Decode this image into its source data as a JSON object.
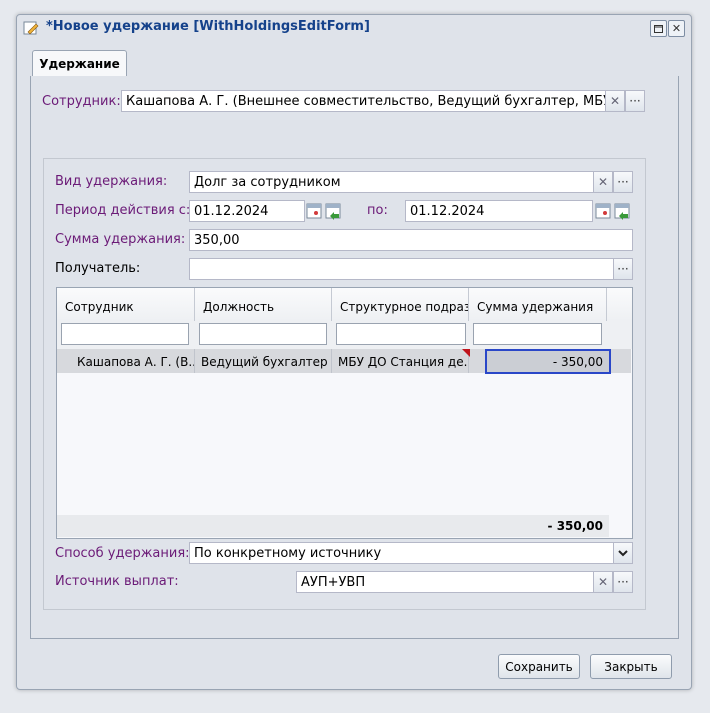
{
  "window": {
    "title": "*Новое удержание [WithHoldingsEditForm]"
  },
  "tab": {
    "label": "Удержание"
  },
  "employee": {
    "label": "Сотрудник:",
    "value": "Кашапова А. Г. (Внешнее совместительство, Ведущий бухгалтер, МБУ ДО Ст"
  },
  "withholding_type": {
    "label": "Вид удержания:",
    "value": "Долг за сотрудником"
  },
  "period": {
    "label": "Период действия с:",
    "from": "01.12.2024",
    "to_label": "по:",
    "to": "01.12.2024"
  },
  "amount": {
    "label": "Сумма удержания:",
    "value": "350,00"
  },
  "recipient": {
    "label": "Получатель:",
    "value": ""
  },
  "grid": {
    "columns": [
      "Сотрудник",
      "Должность",
      "Структурное подраз...",
      "Сумма удержания"
    ],
    "rows": [
      {
        "employee": "Кашапова А. Г. (В...",
        "position": "Ведущий бухгалтер",
        "department": "МБУ ДО Станция де...",
        "amount": "- 350,00"
      }
    ],
    "total": "- 350,00"
  },
  "method": {
    "label": "Способ удержания:",
    "value": "По конкретному источнику"
  },
  "source": {
    "label": "Источник выплат:",
    "value": "АУП+УВП"
  },
  "buttons": {
    "save": "Сохранить",
    "close": "Закрыть"
  },
  "colors": {
    "label_accent": "#6b1a77",
    "selection_border": "#2a47c8",
    "title_text": "#15428b"
  }
}
